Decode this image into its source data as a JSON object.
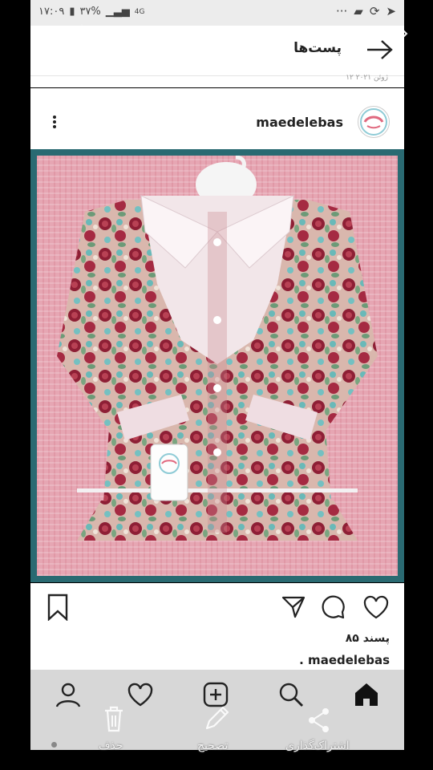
{
  "status_bar": {
    "time": "۱۷:۰۹",
    "battery": "۳۷%",
    "network": "4G"
  },
  "header": {
    "title": "پست‌ها"
  },
  "post": {
    "date": "۱۲ ژوئن ۲۰۲۱",
    "username": "maedelebas",
    "likes": "۸۵ پسند",
    "caption": ". maedelebas"
  },
  "overlay": {
    "share_label": "اشتراک‌گذاری",
    "edit_label": "تصحیح",
    "delete_label": "حذف"
  },
  "colors": {
    "image_border": "#2a6a72",
    "nav_bg": "#d7d7d7"
  }
}
